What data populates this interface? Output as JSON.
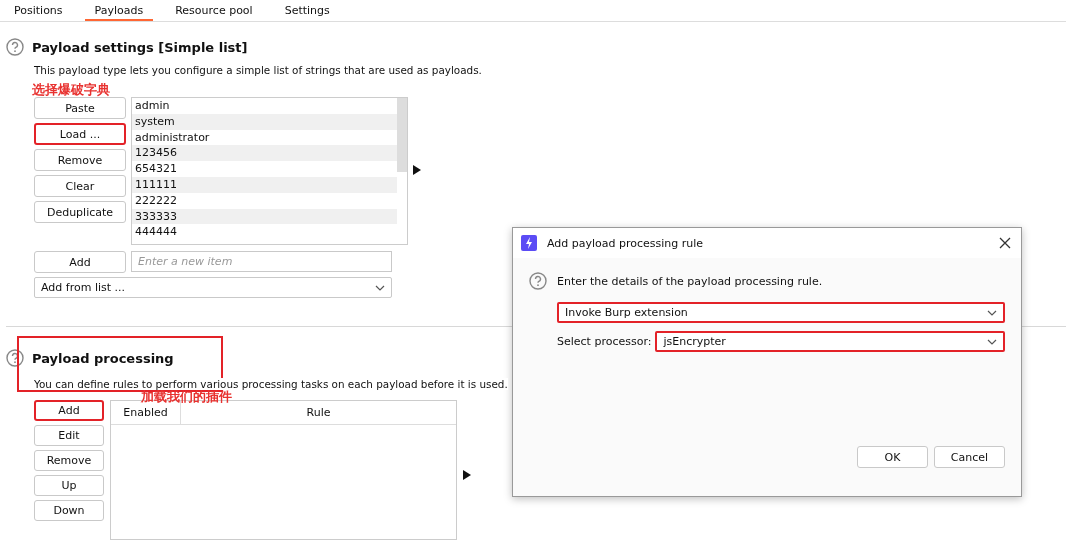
{
  "tabs": [
    {
      "label": "Positions",
      "selected": false
    },
    {
      "label": "Payloads",
      "selected": true
    },
    {
      "label": "Resource pool",
      "selected": false
    },
    {
      "label": "Settings",
      "selected": false
    }
  ],
  "payload_settings": {
    "title": "Payload settings [Simple list]",
    "description": "This payload type lets you configure a simple list of strings that are used as payloads.",
    "annotation": "选择爆破字典",
    "buttons": [
      {
        "label": "Paste",
        "highlighted": false
      },
      {
        "label": "Load ...",
        "highlighted": true
      },
      {
        "label": "Remove",
        "highlighted": false
      },
      {
        "label": "Clear",
        "highlighted": false
      },
      {
        "label": "Deduplicate",
        "highlighted": false
      }
    ],
    "items": [
      "admin",
      "system",
      "administrator",
      "123456",
      "654321",
      "111111",
      "222222",
      "333333",
      "444444"
    ],
    "add_button": "Add",
    "new_item": {
      "placeholder": "Enter a new item"
    },
    "add_from_list": "Add from list ..."
  },
  "payload_processing": {
    "title": "Payload processing",
    "description": "You can define rules to perform various processing tasks on each payload before it is used.",
    "highlighted": true,
    "annotation": "加载我们的插件",
    "buttons": [
      {
        "label": "Add",
        "highlighted": true
      },
      {
        "label": "Edit",
        "highlighted": false
      },
      {
        "label": "Remove",
        "highlighted": false
      },
      {
        "label": "Up",
        "highlighted": false
      },
      {
        "label": "Down",
        "highlighted": false
      }
    ],
    "columns": [
      "Enabled",
      "Rule"
    ]
  },
  "dialog": {
    "title": "Add payload processing rule",
    "prompt": "Enter the details of the payload processing rule.",
    "rule_type": {
      "value": "Invoke Burp extension",
      "highlighted": true
    },
    "processor": {
      "label": "Select processor:",
      "value": "jsEncrypter",
      "highlighted": true
    },
    "buttons": [
      "OK",
      "Cancel"
    ]
  }
}
